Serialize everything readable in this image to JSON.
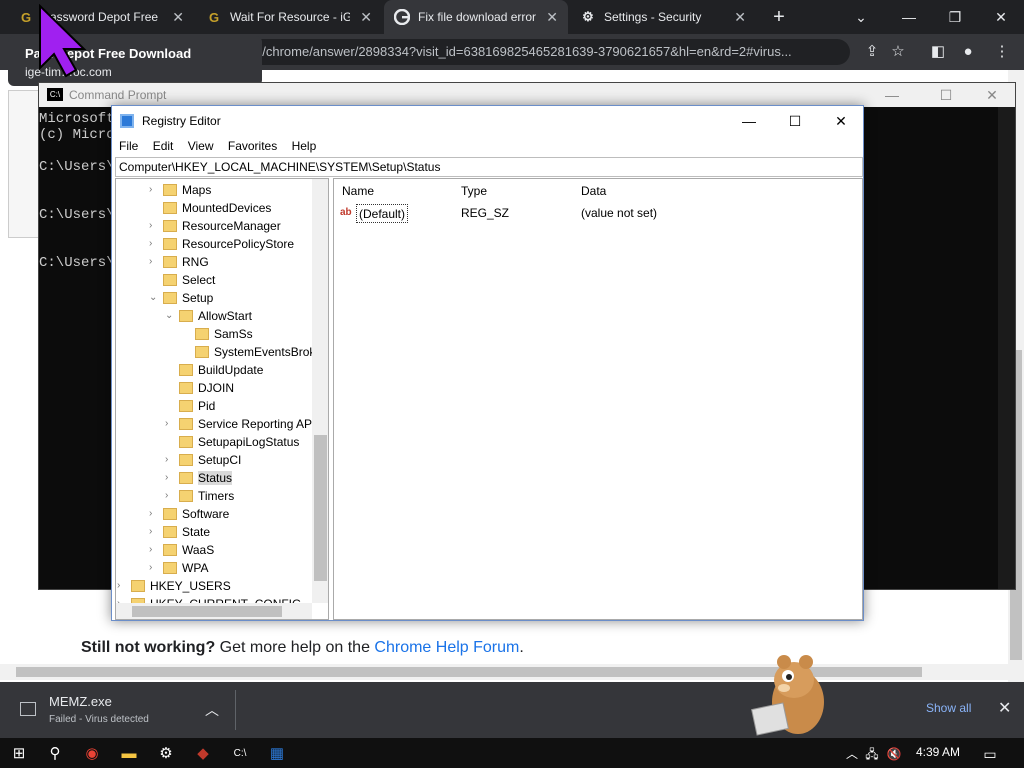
{
  "browser": {
    "tabs": [
      {
        "favicon": "G",
        "title": "Password Depot Free D",
        "active": false
      },
      {
        "favicon": "G",
        "title": "Wait For Resource - iGe",
        "active": false
      },
      {
        "favicon": "google-icon",
        "title": "Fix file download error",
        "active": true
      },
      {
        "favicon": "gear-icon",
        "title": "Settings - Security",
        "active": false
      }
    ],
    "new_tab_label": "+",
    "address_tail": "n/chrome/answer/2898334?visit_id=638169825465281639-3790621657&hl=en&rd=2#virus...",
    "hover_card": {
      "title": "Pa… Depot Free Download",
      "url": "ige-tim…oc.com"
    }
  },
  "page": {
    "help_prefix": "Still not working?",
    "help_middle": " Get more help on the ",
    "help_link": "Chrome Help Forum",
    "help_suffix": "."
  },
  "cmd": {
    "title": "Command Prompt",
    "lines": [
      "Microsoft",
      "(c) Micro",
      "C:\\Users\\",
      "C:\\Users\\",
      "C:\\Users\\"
    ]
  },
  "regedit": {
    "title": "Registry Editor",
    "menu": [
      "File",
      "Edit",
      "View",
      "Favorites",
      "Help"
    ],
    "address": "Computer\\HKEY_LOCAL_MACHINE\\SYSTEM\\Setup\\Status",
    "tree": [
      {
        "label": "Maps",
        "level": 0,
        "expander": ">"
      },
      {
        "label": "MountedDevices",
        "level": 0,
        "expander": ""
      },
      {
        "label": "ResourceManager",
        "level": 0,
        "expander": ">"
      },
      {
        "label": "ResourcePolicyStore",
        "level": 0,
        "expander": ">"
      },
      {
        "label": "RNG",
        "level": 0,
        "expander": ">"
      },
      {
        "label": "Select",
        "level": 0,
        "expander": ""
      },
      {
        "label": "Setup",
        "level": 0,
        "expander": "v"
      },
      {
        "label": "AllowStart",
        "level": 1,
        "expander": "v"
      },
      {
        "label": "SamSs",
        "level": 2,
        "expander": ""
      },
      {
        "label": "SystemEventsBroker",
        "level": 2,
        "expander": ""
      },
      {
        "label": "BuildUpdate",
        "level": 1,
        "expander": ""
      },
      {
        "label": "DJOIN",
        "level": 1,
        "expander": ""
      },
      {
        "label": "Pid",
        "level": 1,
        "expander": ""
      },
      {
        "label": "Service Reporting API",
        "level": 1,
        "expander": ">"
      },
      {
        "label": "SetupapiLogStatus",
        "level": 1,
        "expander": ""
      },
      {
        "label": "SetupCI",
        "level": 1,
        "expander": ">"
      },
      {
        "label": "Status",
        "level": 1,
        "expander": ">",
        "selected": true
      },
      {
        "label": "Timers",
        "level": 1,
        "expander": ">"
      },
      {
        "label": "Software",
        "level": 0,
        "expander": ">"
      },
      {
        "label": "State",
        "level": 0,
        "expander": ">"
      },
      {
        "label": "WaaS",
        "level": 0,
        "expander": ">"
      },
      {
        "label": "WPA",
        "level": 0,
        "expander": ">"
      },
      {
        "label": "HKEY_USERS",
        "level": -2,
        "expander": ">"
      },
      {
        "label": "HKEY_CURRENT_CONFIG",
        "level": -2,
        "expander": ">"
      }
    ],
    "columns": {
      "name": "Name",
      "type": "Type",
      "data": "Data"
    },
    "values": [
      {
        "name": "(Default)",
        "type": "REG_SZ",
        "data": "(value not set)"
      }
    ]
  },
  "downloads": {
    "file": "MEMZ.exe",
    "status": "Failed - Virus detected",
    "show_all": "Show all"
  },
  "taskbar": {
    "time": "4:39 AM"
  }
}
